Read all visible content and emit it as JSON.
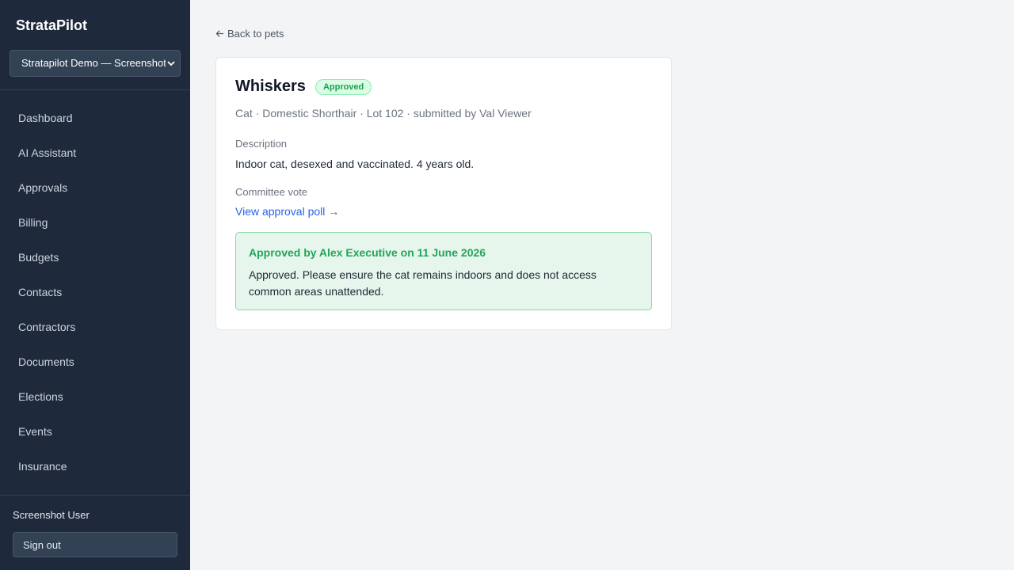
{
  "sidebar": {
    "brand": "StrataPilot",
    "org_selector": "Stratapilot Demo — Screenshot",
    "items": [
      {
        "label": "Dashboard"
      },
      {
        "label": "AI Assistant"
      },
      {
        "label": "Approvals"
      },
      {
        "label": "Billing"
      },
      {
        "label": "Budgets"
      },
      {
        "label": "Contacts"
      },
      {
        "label": "Contractors"
      },
      {
        "label": "Documents"
      },
      {
        "label": "Elections"
      },
      {
        "label": "Events"
      },
      {
        "label": "Insurance"
      }
    ],
    "user_name": "Screenshot User",
    "sign_out": "Sign out"
  },
  "main": {
    "back_link": "Back to pets",
    "pet": {
      "name": "Whiskers",
      "status": "Approved",
      "meta": "Cat · Domestic Shorthair · Lot 102 · submitted by Val Viewer",
      "description_label": "Description",
      "description": "Indoor cat, desexed and vaccinated. 4 years old.",
      "vote_label": "Committee vote",
      "poll_link": "View approval poll →",
      "approval_heading": "Approved by Alex Executive on 11 June 2026",
      "approval_note": "Approved. Please ensure the cat remains indoors and does not access common areas unattended."
    }
  },
  "colors": {
    "sidebar_bg": "#1e293b",
    "accent_link": "#2563eb",
    "approved_green": "#22a55a"
  },
  "icons": {
    "back": "arrow-left-icon",
    "org_select": "chevron-down-icon"
  }
}
